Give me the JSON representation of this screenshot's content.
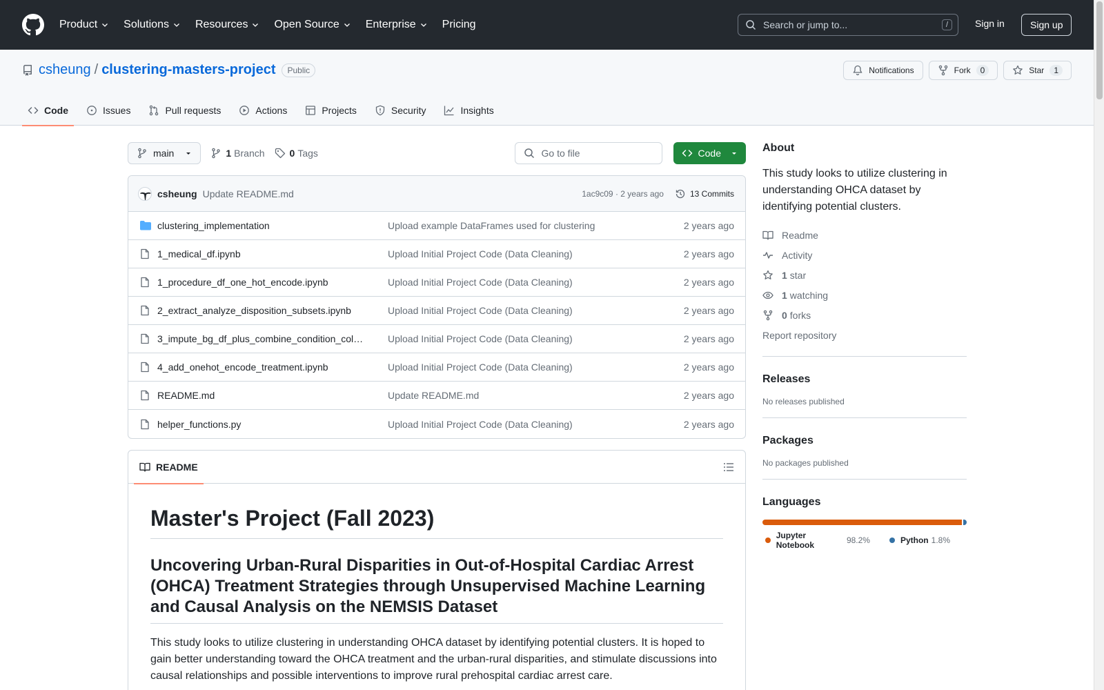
{
  "header": {
    "nav": [
      {
        "label": "Product",
        "dropdown": true
      },
      {
        "label": "Solutions",
        "dropdown": true
      },
      {
        "label": "Resources",
        "dropdown": true
      },
      {
        "label": "Open Source",
        "dropdown": true
      },
      {
        "label": "Enterprise",
        "dropdown": true
      },
      {
        "label": "Pricing",
        "dropdown": false
      }
    ],
    "search_placeholder": "Search or jump to...",
    "search_key": "/",
    "sign_in": "Sign in",
    "sign_up": "Sign up"
  },
  "repo": {
    "owner": "csheung",
    "separator": "/",
    "name": "clustering-masters-project",
    "visibility": "Public",
    "notifications_label": "Notifications",
    "fork_label": "Fork",
    "fork_count": "0",
    "star_label": "Star",
    "star_count": "1",
    "tabs": [
      {
        "label": "Code",
        "icon": "code-icon",
        "active": true
      },
      {
        "label": "Issues",
        "icon": "issue-icon",
        "active": false
      },
      {
        "label": "Pull requests",
        "icon": "pull-request-icon",
        "active": false
      },
      {
        "label": "Actions",
        "icon": "play-icon",
        "active": false
      },
      {
        "label": "Projects",
        "icon": "table-icon",
        "active": false
      },
      {
        "label": "Security",
        "icon": "shield-icon",
        "active": false
      },
      {
        "label": "Insights",
        "icon": "graph-icon",
        "active": false
      }
    ]
  },
  "toolbar": {
    "branch": "main",
    "branch_count": "1",
    "branch_label": "Branch",
    "tag_count": "0",
    "tag_label": "Tags",
    "go_to_file": "Go to file",
    "code_button": "Code"
  },
  "latest_commit": {
    "author": "csheung",
    "message": "Update README.md",
    "hash_time": "1ac9c09 · 2 years ago",
    "commits_label": "13 Commits"
  },
  "files": [
    {
      "type": "folder",
      "name": "clustering_implementation",
      "message": "Upload example DataFrames used for clustering",
      "date": "2 years ago"
    },
    {
      "type": "file",
      "name": "1_medical_df.ipynb",
      "message": "Upload Initial Project Code (Data Cleaning)",
      "date": "2 years ago"
    },
    {
      "type": "file",
      "name": "1_procedure_df_one_hot_encode.ipynb",
      "message": "Upload Initial Project Code (Data Cleaning)",
      "date": "2 years ago"
    },
    {
      "type": "file",
      "name": "2_extract_analyze_disposition_subsets.ipynb",
      "message": "Upload Initial Project Code (Data Cleaning)",
      "date": "2 years ago"
    },
    {
      "type": "file",
      "name": "3_impute_bg_df_plus_combine_condition_col…",
      "message": "Upload Initial Project Code (Data Cleaning)",
      "date": "2 years ago"
    },
    {
      "type": "file",
      "name": "4_add_onehot_encode_treatment.ipynb",
      "message": "Upload Initial Project Code (Data Cleaning)",
      "date": "2 years ago"
    },
    {
      "type": "file",
      "name": "README.md",
      "message": "Update README.md",
      "date": "2 years ago"
    },
    {
      "type": "file",
      "name": "helper_functions.py",
      "message": "Upload Initial Project Code (Data Cleaning)",
      "date": "2 years ago"
    }
  ],
  "readme": {
    "tab_label": "README",
    "h1": "Master's Project (Fall 2023)",
    "h2": "Uncovering Urban-Rural Disparities in Out-of-Hospital Cardiac Arrest (OHCA) Treatment Strategies through Unsupervised Machine Learning and Causal Analysis on the NEMSIS Dataset",
    "paragraph": "This study looks to utilize clustering in understanding OHCA dataset by identifying potential clusters. It is hoped to gain better understanding toward the OHCA treatment and the urban-rural disparities, and stimulate discussions into causal relationships and possible interventions to improve rural prehospital cardiac arrest care."
  },
  "sidebar": {
    "about_title": "About",
    "about_text": "This study looks to utilize clustering in understanding OHCA dataset by identifying potential clusters.",
    "readme_link": "Readme",
    "activity_link": "Activity",
    "stars_count": "1",
    "stars_label": "star",
    "watching_count": "1",
    "watching_label": "watching",
    "forks_count": "0",
    "forks_label": "forks",
    "report_link": "Report repository",
    "releases_title": "Releases",
    "releases_text": "No releases published",
    "packages_title": "Packages",
    "packages_text": "No packages published",
    "languages_title": "Languages",
    "languages": [
      {
        "name": "Jupyter Notebook",
        "percent": "98.2%",
        "value": 98.2,
        "color": "#DA5B0B"
      },
      {
        "name": "Python",
        "percent": "1.8%",
        "value": 1.8,
        "color": "#3572A5"
      }
    ]
  }
}
